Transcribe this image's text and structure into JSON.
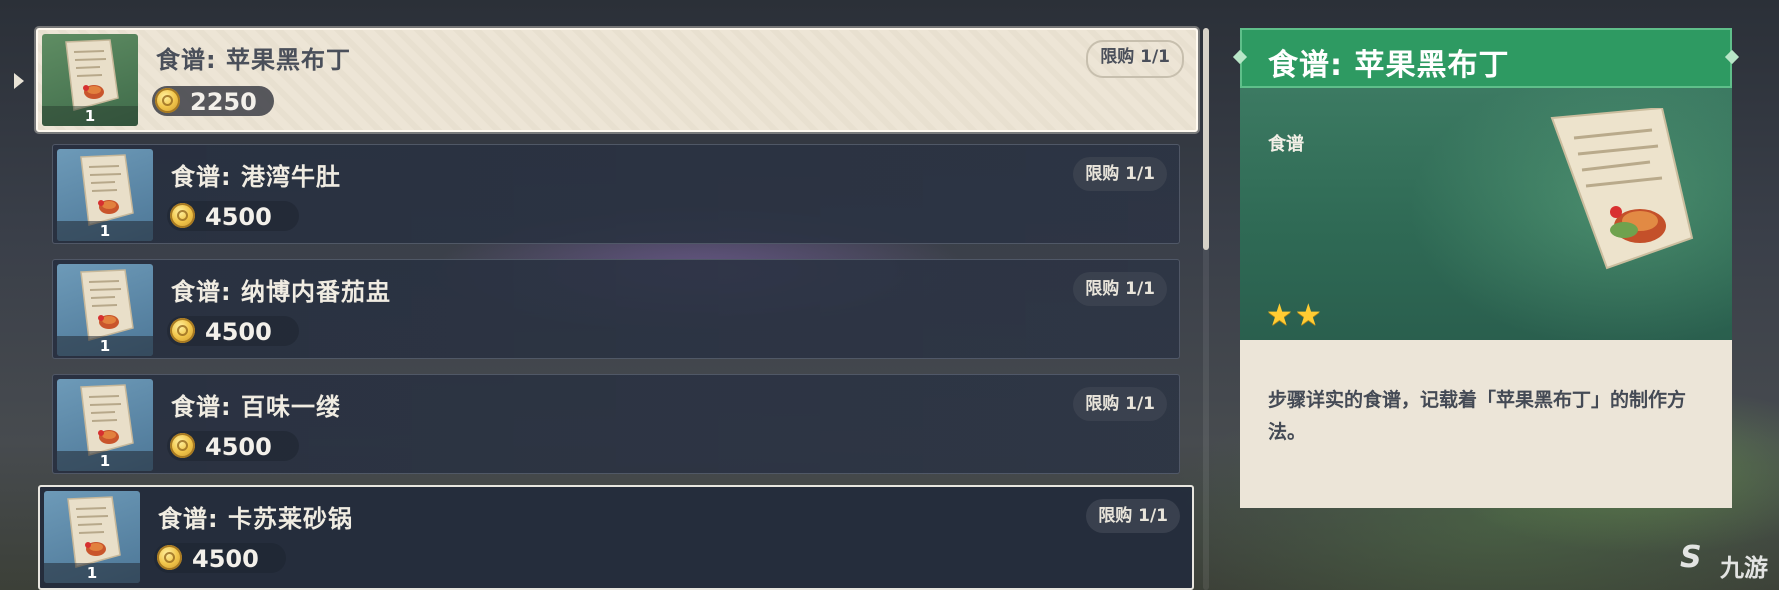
{
  "items": [
    {
      "name": "食谱: 苹果黑布丁",
      "price": "2250",
      "limit": "限购 1/1",
      "count": "1",
      "state": "selected"
    },
    {
      "name": "食谱: 港湾牛肚",
      "price": "4500",
      "limit": "限购 1/1",
      "count": "1",
      "state": "normal"
    },
    {
      "name": "食谱: 纳博内番茄盅",
      "price": "4500",
      "limit": "限购 1/1",
      "count": "1",
      "state": "normal"
    },
    {
      "name": "食谱: 百味一缕",
      "price": "4500",
      "limit": "限购 1/1",
      "count": "1",
      "state": "normal"
    },
    {
      "name": "食谱: 卡苏莱砂锅",
      "price": "4500",
      "limit": "限购 1/1",
      "count": "1",
      "state": "hovered"
    }
  ],
  "detail": {
    "title": "食谱: 苹果黑布丁",
    "type": "食谱",
    "rarity": 2,
    "description": "步骤详实的食谱，记载着「苹果黑布丁」的制作方法。"
  },
  "scroll": {
    "position": 0
  },
  "colors": {
    "header_green": "#2e9a62",
    "selected_bg": "#ede5d6",
    "star": "#ffcc33",
    "coin": "#f2c64b"
  },
  "icons": {
    "thumb": "recipe-scroll-icon",
    "currency": "mora-coin-icon",
    "rarity": "star-icon"
  },
  "watermark": {
    "glyph": "S",
    "text": "九游"
  }
}
